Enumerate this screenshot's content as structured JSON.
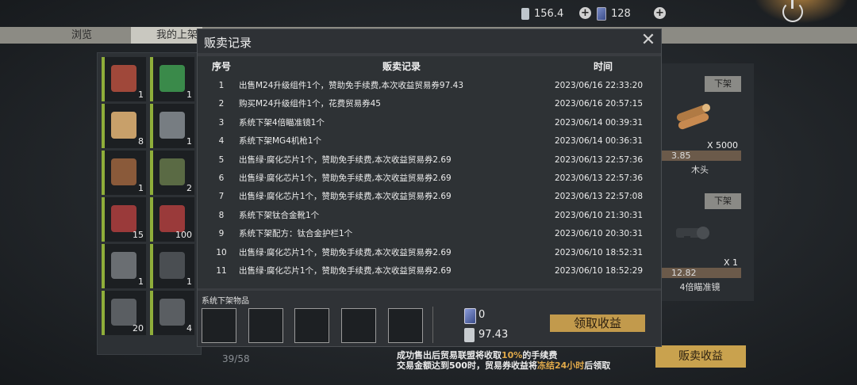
{
  "top": {
    "resource1": "156.4",
    "resource2": "128",
    "plus": "+"
  },
  "tabs": [
    {
      "label": "浏览"
    },
    {
      "label": "我的上架"
    }
  ],
  "inventory": {
    "slots": [
      {
        "count": "1",
        "icon": "backpack-icon",
        "color": "#a0483a"
      },
      {
        "count": "1",
        "icon": "chemical-box-icon",
        "color": "#3a8a4a"
      },
      {
        "count": "8",
        "icon": "scroll-icon",
        "color": "#c8a06a"
      },
      {
        "count": "1",
        "icon": "syringe-icon",
        "color": "#777d82"
      },
      {
        "count": "1",
        "icon": "axe-icon",
        "color": "#8a5a3a"
      },
      {
        "count": "2",
        "icon": "grenade-icon",
        "color": "#5a6a44"
      },
      {
        "count": "15",
        "icon": "ammo-icon",
        "color": "#9a3a3a"
      },
      {
        "count": "100",
        "icon": "ammo-icon",
        "color": "#9a3a3a"
      },
      {
        "count": "1",
        "icon": "weapon-part-icon",
        "color": "#6a6e72"
      },
      {
        "count": "1",
        "icon": "weapon-part-icon",
        "color": "#4a4e52"
      },
      {
        "count": "20",
        "icon": "rifle-icon",
        "color": "#5a5e62"
      },
      {
        "count": "4",
        "icon": "rifle-icon",
        "color": "#5a5e62"
      }
    ],
    "pager": "39/58"
  },
  "market": {
    "items": [
      {
        "off_label": "下架",
        "qty": "X 5000",
        "price": "3.85",
        "name": "木头"
      },
      {
        "off_label": "下架",
        "qty": "X 1",
        "price": "12.82",
        "name": "4倍瞄准镜"
      }
    ],
    "sell_income": "贩卖收益"
  },
  "modal": {
    "title": "贩卖记录",
    "close": "✕",
    "headers": {
      "no": "序号",
      "record": "贩卖记录",
      "time": "时间"
    },
    "rows": [
      {
        "no": "1",
        "record": "出售M24升级组件1个，赞助免手续费,本次收益贸易券97.43",
        "time": "2023/06/16 22:33:20"
      },
      {
        "no": "2",
        "record": "购买M24升级组件1个，花费贸易券45",
        "time": "2023/06/16 20:57:15"
      },
      {
        "no": "3",
        "record": "系统下架4倍瞄准镜1个",
        "time": "2023/06/14 00:39:31"
      },
      {
        "no": "4",
        "record": "系统下架MG4机枪1个",
        "time": "2023/06/14 00:36:31"
      },
      {
        "no": "5",
        "record": "出售绿·腐化芯片1个，赞助免手续费,本次收益贸易券2.69",
        "time": "2023/06/13 22:57:36"
      },
      {
        "no": "6",
        "record": "出售绿·腐化芯片1个，赞助免手续费,本次收益贸易券2.69",
        "time": "2023/06/13 22:57:36"
      },
      {
        "no": "7",
        "record": "出售绿·腐化芯片1个，赞助免手续费,本次收益贸易券2.69",
        "time": "2023/06/13 22:57:08"
      },
      {
        "no": "8",
        "record": "系统下架钛合金靴1个",
        "time": "2023/06/10 21:30:31"
      },
      {
        "no": "9",
        "record": "系统下架配方：钛合金护栏1个",
        "time": "2023/06/10 20:30:31"
      },
      {
        "no": "10",
        "record": "出售绿·腐化芯片1个，赞助免手续费,本次收益贸易券2.69",
        "time": "2023/06/10 18:52:31"
      },
      {
        "no": "11",
        "record": "出售绿·腐化芯片1个，赞助免手续费,本次收益贸易券2.69",
        "time": "2023/06/10 18:52:29"
      }
    ],
    "footer": {
      "label": "系统下架物品",
      "card_value": "0",
      "voucher_value": "97.43",
      "claim_label": "领取收益"
    }
  },
  "notice": {
    "line1_a": "成功售出后贸易联盟将收取",
    "line1_hl": "10%",
    "line1_b": "的手续费",
    "line2_a": "交易金额达到500时，贸易券收益将",
    "line2_hl": "冻结24小时",
    "line2_b": "后领取"
  }
}
